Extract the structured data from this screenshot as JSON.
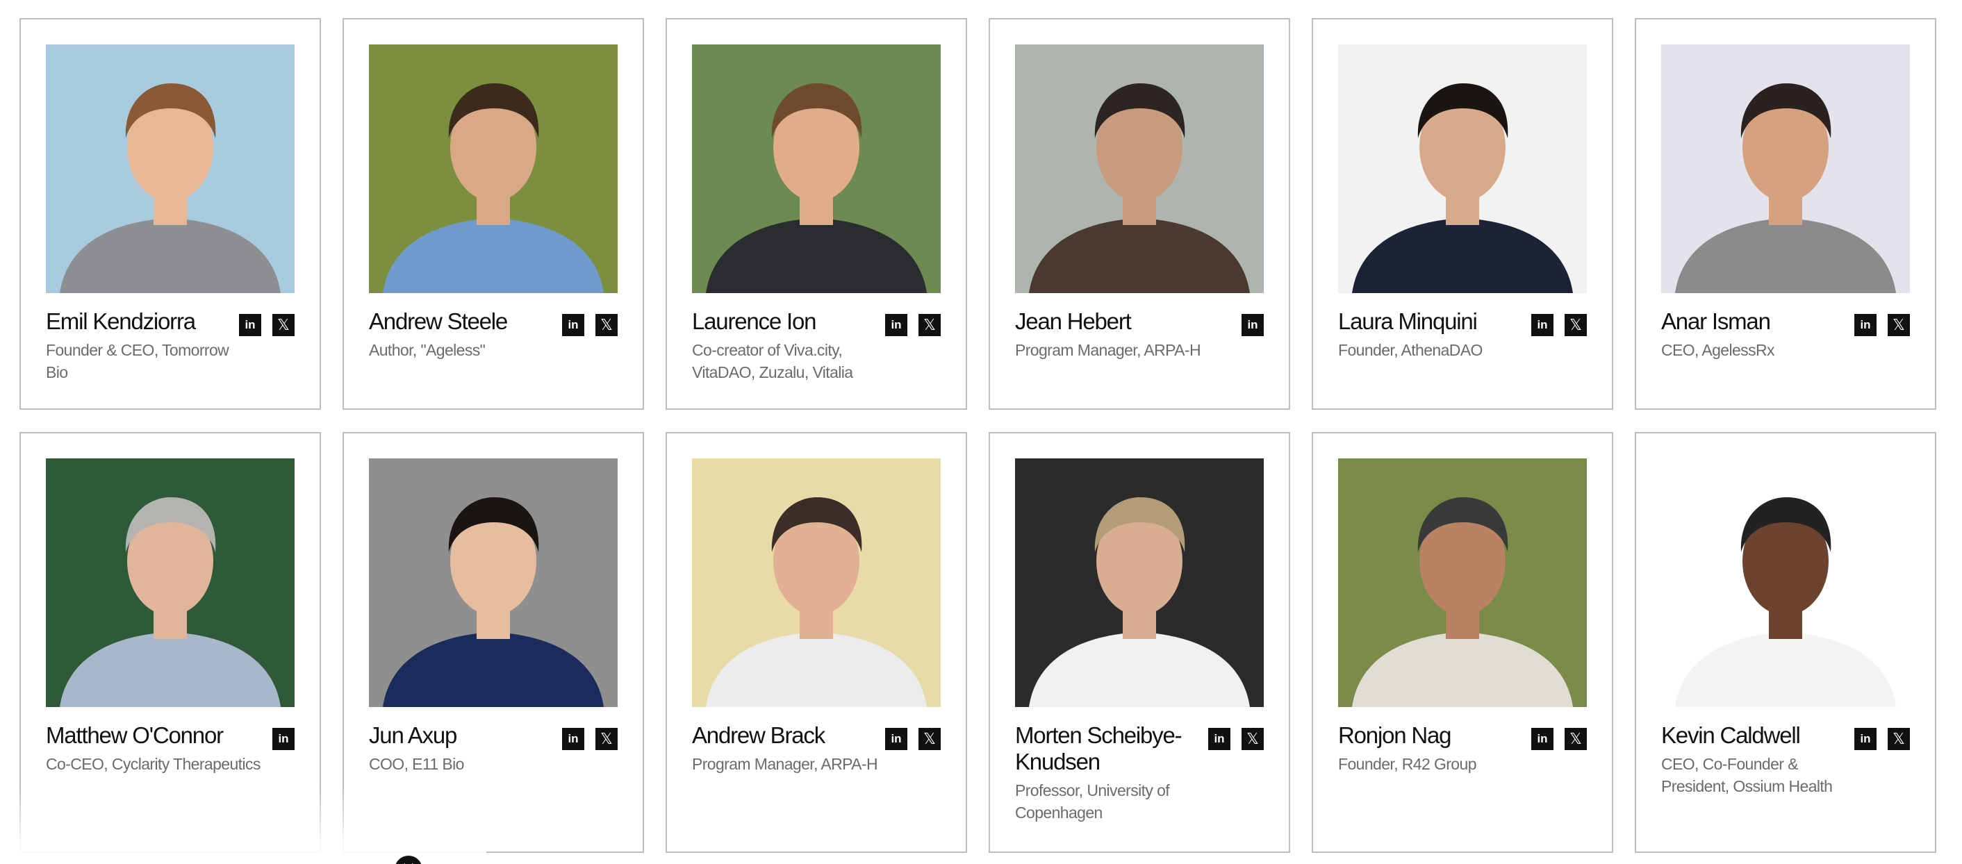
{
  "people": [
    {
      "name": "Emil Kendziorra",
      "role": "Founder & CEO, Tomorrow Bio",
      "linkedin": true,
      "x": true,
      "bg": "#a9cbe0",
      "shirt": "#8d8f93",
      "hair": "#8a5a36",
      "skin": "#e8b796"
    },
    {
      "name": "Andrew Steele",
      "role": "Author, \"Ageless\"",
      "linkedin": true,
      "x": true,
      "bg": "#7c8f3e",
      "shirt": "#6f9acb",
      "hair": "#3d2a1d",
      "skin": "#d9a887"
    },
    {
      "name": "Laurence Ion",
      "role": "Co-creator of Viva.city, VitaDAO, Zuzalu, Vitalia",
      "linkedin": true,
      "x": true,
      "bg": "#6d8a52",
      "shirt": "#2b2c30",
      "hair": "#6e4a2e",
      "skin": "#e1ac8a"
    },
    {
      "name": "Jean Hebert",
      "role": "Program Manager, ARPA-H",
      "linkedin": true,
      "x": false,
      "bg": "#aeb4ae",
      "shirt": "#4b3a31",
      "hair": "#2d2522",
      "skin": "#c99b7d"
    },
    {
      "name": "Laura Minquini",
      "role": "Founder, AthenaDAO",
      "linkedin": true,
      "x": true,
      "bg": "#f2f2f2",
      "shirt": "#1d2336",
      "hair": "#1b1512",
      "skin": "#d9a98c"
    },
    {
      "name": "Anar Isman",
      "role": "CEO, AgelessRx",
      "linkedin": true,
      "x": true,
      "bg": "#e4e2ea",
      "shirt": "#8c8a8a",
      "hair": "#2b2220",
      "skin": "#d6a17e"
    },
    {
      "name": "Matthew O'Connor",
      "role": "Co-CEO, Cyclarity Therapeutics",
      "linkedin": true,
      "x": false,
      "bg": "#2f5a3a",
      "shirt": "#a9b7cb",
      "hair": "#b5b3af",
      "skin": "#e0b59a"
    },
    {
      "name": "Jun Axup",
      "role": "COO, E11 Bio",
      "linkedin": true,
      "x": true,
      "bg": "#8f8f8f",
      "shirt": "#1b2b5c",
      "hair": "#1a1412",
      "skin": "#e6bd9e"
    },
    {
      "name": "Andrew Brack",
      "role": "Program Manager, ARPA-H",
      "linkedin": true,
      "x": true,
      "bg": "#e9dba8",
      "shirt": "#ececec",
      "hair": "#3b2e28",
      "skin": "#e2b193"
    },
    {
      "name": "Morten Scheibye-Knudsen",
      "role": "Professor, University of Copenhagen",
      "linkedin": true,
      "x": true,
      "bg": "#2b2b2b",
      "shirt": "#f1f1f1",
      "hair": "#b49c78",
      "skin": "#d9ad91"
    },
    {
      "name": "Ronjon Nag",
      "role": "Founder, R42 Group",
      "linkedin": true,
      "x": true,
      "bg": "#7a8b4a",
      "shirt": "#e2ddd2",
      "hair": "#3a3a3a",
      "skin": "#b98363"
    },
    {
      "name": "Kevin Caldwell",
      "role": "CEO, Co-Founder & President, Ossium Health",
      "linkedin": true,
      "x": true,
      "bg": "#ffffff",
      "shirt": "#f4f4f2",
      "hair": "#222222",
      "skin": "#6b432e"
    }
  ],
  "social": {
    "linkedin_label": "in",
    "x_label": "𝕏"
  },
  "close_label": "✕"
}
